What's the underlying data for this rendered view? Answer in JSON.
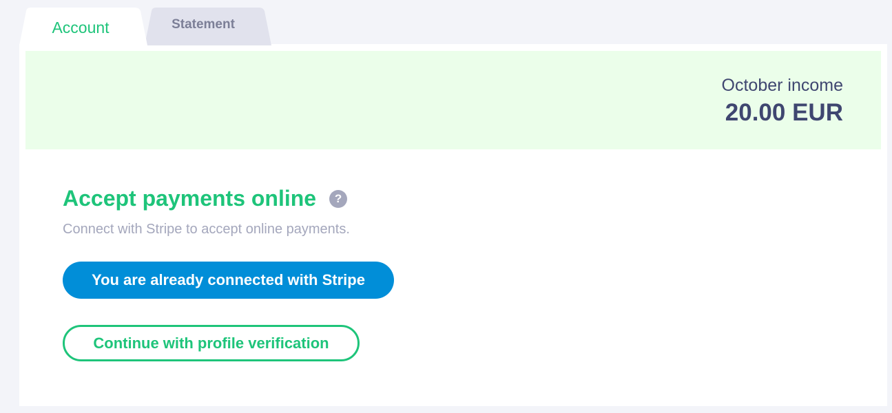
{
  "tabs": [
    {
      "label": "Account",
      "active": true
    },
    {
      "label": "Statement",
      "active": false
    }
  ],
  "income": {
    "label": "October income",
    "amount": "20.00 EUR"
  },
  "payments": {
    "title": "Accept payments online",
    "help_icon": "?",
    "description": "Connect with Stripe to accept online payments.",
    "stripe_button": "You are already connected with Stripe",
    "verify_button": "Continue with profile verification"
  },
  "colors": {
    "accent_green": "#1ec47a",
    "stripe_blue": "#018ed8",
    "banner_bg": "#ebfeea",
    "text_dark": "#3f4670",
    "text_muted": "#a4a7bc",
    "page_bg": "#f3f4f9",
    "inactive_tab_bg": "#e1e2ed"
  }
}
